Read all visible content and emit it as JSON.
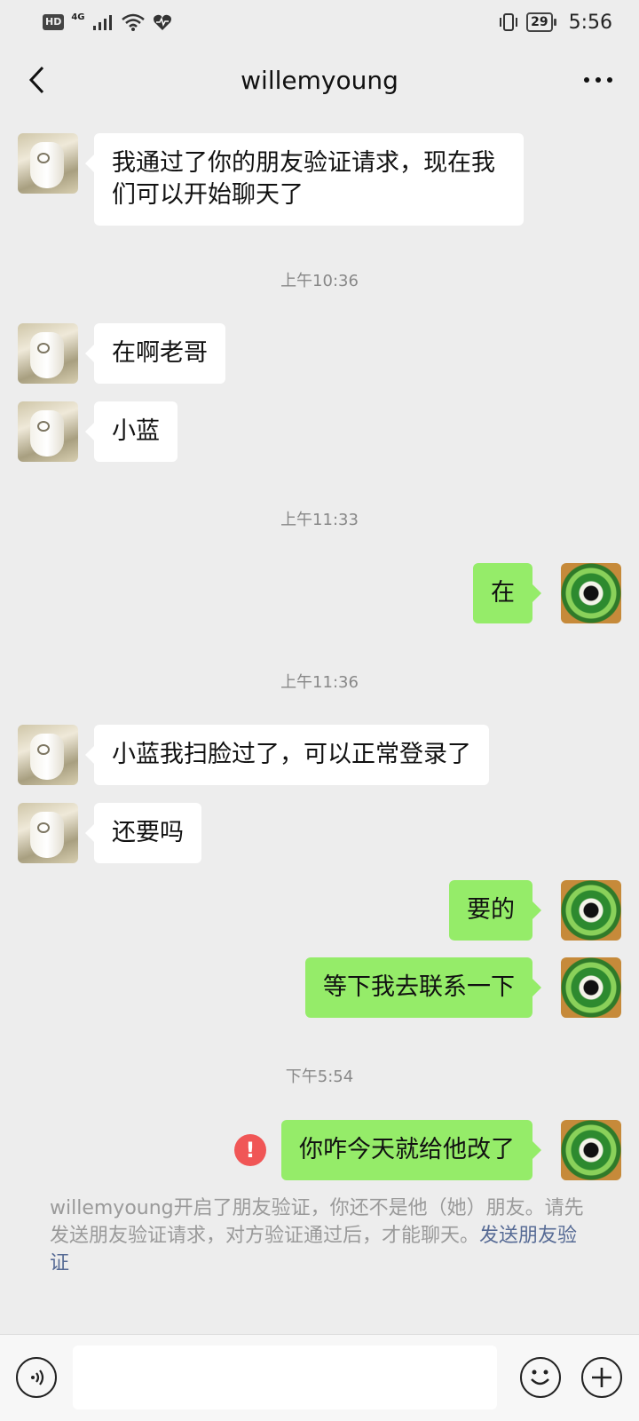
{
  "status_bar": {
    "hd_badge": "HD",
    "network": "4G",
    "battery": "29",
    "time": "5:56",
    "icons": [
      "signal-icon",
      "wifi-icon",
      "health-icon",
      "vibrate-icon",
      "battery-icon"
    ]
  },
  "header": {
    "title": "willemyoung",
    "back_icon": "chevron-left-icon",
    "more_icon": "more-icon"
  },
  "messages": [
    {
      "from": "peer",
      "text": "我通过了你的朋友验证请求，现在我们可以开始聊天了"
    },
    {
      "type": "time",
      "text": "上午10:36"
    },
    {
      "from": "peer",
      "text": "在啊老哥"
    },
    {
      "from": "peer",
      "text": "小蓝"
    },
    {
      "type": "time",
      "text": "上午11:33"
    },
    {
      "from": "me",
      "text": "在"
    },
    {
      "type": "time",
      "text": "上午11:36"
    },
    {
      "from": "peer",
      "text": "小蓝我扫脸过了，可以正常登录了"
    },
    {
      "from": "peer",
      "text": "还要吗"
    },
    {
      "from": "me",
      "text": "要的"
    },
    {
      "from": "me",
      "text": "等下我去联系一下"
    },
    {
      "type": "time",
      "text": "下午5:54"
    },
    {
      "from": "me",
      "text": "你咋今天就给他改了",
      "status": "failed",
      "status_icon": "!"
    }
  ],
  "system_notice": {
    "text": "willemyoung开启了朋友验证，你还不是他（她）朋友。请先发送朋友验证请求，对方验证通过后，才能聊天。",
    "link": "发送朋友验证"
  },
  "input_bar": {
    "value": "",
    "voice_icon": "voice-icon",
    "emoji_icon": "emoji-icon",
    "plus_icon": "plus-icon"
  },
  "colors": {
    "background": "#ededed",
    "my_bubble": "#95ec69",
    "peer_bubble": "#ffffff",
    "error": "#f05656",
    "link": "#576b95"
  }
}
